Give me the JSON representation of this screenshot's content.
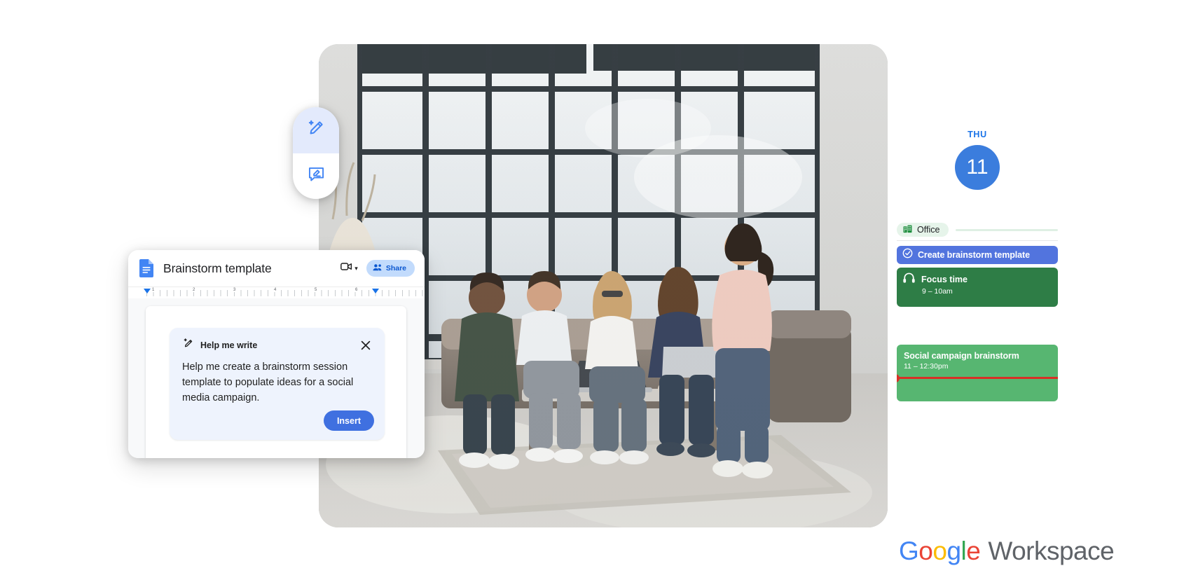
{
  "hero_photo": {
    "alt": "Five colleagues collaborating on couches in a bright loft office with large windows"
  },
  "ai_toolbar": {
    "items": [
      {
        "icon": "magic-pencil-icon",
        "name": "help-me-write",
        "active": true
      },
      {
        "icon": "comment-edit-icon",
        "name": "annotate",
        "active": false
      }
    ]
  },
  "docs": {
    "app_icon": "google-docs-icon",
    "title": "Brainstorm template",
    "camera_icon": "video-camera-icon",
    "camera_caret": "▾",
    "share_icon": "share-people-icon",
    "share_label": "Share",
    "ruler": {
      "numbers": [
        "1",
        "2",
        "3",
        "4",
        "5",
        "6"
      ]
    }
  },
  "help_me_write": {
    "icon": "magic-pencil-icon",
    "title": "Help me write",
    "close_icon": "close-icon",
    "prompt": "Help me create a brainstorm session template to populate ideas for a social media campaign.",
    "insert_label": "Insert"
  },
  "calendar": {
    "day_of_week": "THU",
    "day_number": "11",
    "location_chip": {
      "icon": "office-building-icon",
      "label": "Office"
    },
    "events": [
      {
        "name": "task",
        "icon": "check-circle-icon",
        "title": "Create brainstorm template",
        "time": "",
        "color": "#5274de"
      },
      {
        "name": "focus-time",
        "icon": "headphones-icon",
        "title": "Focus time",
        "time": "9 – 10am",
        "color": "#2e7d46"
      },
      {
        "name": "social-campaign-brainstorm",
        "icon": "",
        "title": "Social campaign brainstorm",
        "time": "11 – 12:30pm",
        "color": "#57b671"
      }
    ],
    "current_time_indicator_color": "#d93025"
  },
  "logo": {
    "g1": "G",
    "o1": "o",
    "o2": "o",
    "g2": "g",
    "l": "l",
    "e": "e",
    "workspace": "Workspace"
  },
  "colors": {
    "brand_blue": "#4285f4",
    "brand_red": "#ea4335",
    "brand_yellow": "#fbbc05",
    "brand_green": "#34a853",
    "docs_blue": "#1a73e8",
    "card_bg": "#eef3fd",
    "insert_button": "#3f70e0"
  }
}
